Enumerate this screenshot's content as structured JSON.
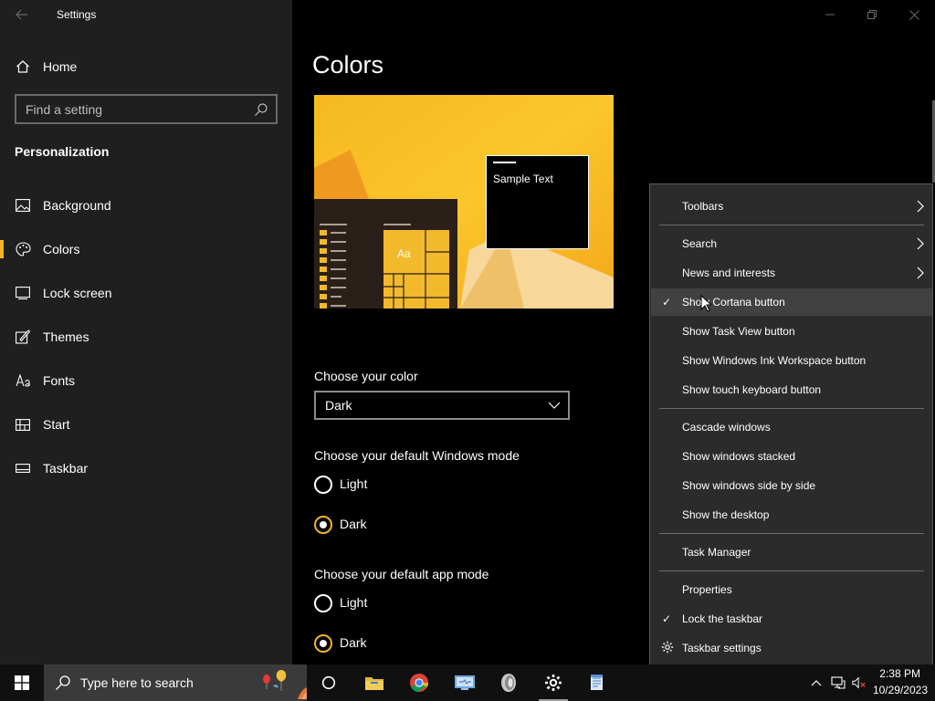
{
  "window": {
    "title": "Settings"
  },
  "sidebar": {
    "home_label": "Home",
    "search_placeholder": "Find a setting",
    "section_title": "Personalization",
    "items": [
      {
        "label": "Background",
        "icon": "picture-icon"
      },
      {
        "label": "Colors",
        "icon": "palette-icon",
        "selected": true
      },
      {
        "label": "Lock screen",
        "icon": "lock-screen-icon"
      },
      {
        "label": "Themes",
        "icon": "themes-icon"
      },
      {
        "label": "Fonts",
        "icon": "fonts-icon"
      },
      {
        "label": "Start",
        "icon": "start-icon"
      },
      {
        "label": "Taskbar",
        "icon": "taskbar-icon"
      }
    ],
    "accent_color": "#f0b429"
  },
  "main": {
    "page_title": "Colors",
    "preview": {
      "sample_text": "Sample Text",
      "tile_text": "Aa"
    },
    "choose_color_label": "Choose your color",
    "color_dropdown_value": "Dark",
    "windows_mode_label": "Choose your default Windows mode",
    "windows_mode_options": [
      "Light",
      "Dark"
    ],
    "windows_mode_selected": "Dark",
    "app_mode_label": "Choose your default app mode",
    "app_mode_options": [
      "Light",
      "Dark"
    ],
    "app_mode_selected": "Dark"
  },
  "context_menu": {
    "items": [
      {
        "label": "Toolbars",
        "submenu": true
      },
      {
        "label": "Search",
        "submenu": true
      },
      {
        "label": "News and interests",
        "submenu": true
      },
      {
        "label": "Show Cortana button",
        "checked": true,
        "hovered": true
      },
      {
        "label": "Show Task View button"
      },
      {
        "label": "Show Windows Ink Workspace button"
      },
      {
        "label": "Show touch keyboard button"
      },
      {
        "label": "Cascade windows"
      },
      {
        "label": "Show windows stacked"
      },
      {
        "label": "Show windows side by side"
      },
      {
        "label": "Show the desktop"
      },
      {
        "label": "Task Manager"
      },
      {
        "label": "Properties"
      },
      {
        "label": "Lock the taskbar",
        "checked": true
      },
      {
        "label": "Taskbar settings",
        "icon": "gear-icon"
      }
    ]
  },
  "taskbar": {
    "search_text": "Type here to search",
    "apps": [
      "cortana-icon",
      "file-explorer-icon",
      "chrome-icon",
      "network-app-icon",
      "media-app-icon",
      "settings-icon",
      "notepad-app-icon"
    ],
    "time": "2:38 PM",
    "date": "10/29/2023"
  }
}
